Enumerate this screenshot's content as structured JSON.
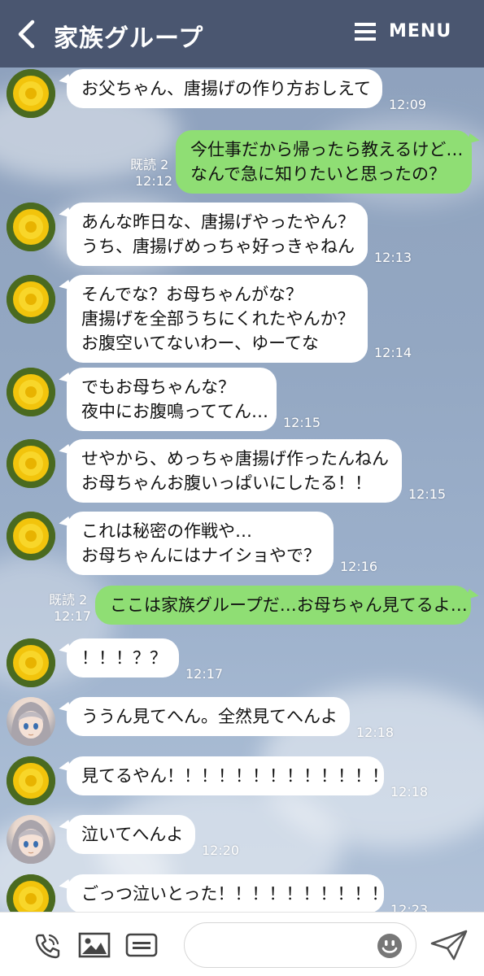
{
  "header": {
    "title": "家族グループ",
    "menu_label": "MENU"
  },
  "messages": [
    {
      "side": "left",
      "avatar": "dandelion",
      "lines": [
        "お父ちゃん、唐揚げの作り方おしえて"
      ],
      "time": "12:09"
    },
    {
      "side": "right",
      "read": "既読 2",
      "lines": [
        "今仕事だから帰ったら教えるけど…",
        "なんで急に知りたいと思ったの？"
      ],
      "time": "12:12"
    },
    {
      "side": "left",
      "avatar": "dandelion",
      "lines": [
        "あんな昨日な、唐揚げやったやん？",
        "うち、唐揚げめっちゃ好っきゃねん"
      ],
      "time": "12:13"
    },
    {
      "side": "left",
      "avatar": "dandelion",
      "lines": [
        "そんでな？お母ちゃんがな？",
        "唐揚げを全部うちにくれたやんか？",
        "お腹空いてないわー、ゆーてな"
      ],
      "time": "12:14"
    },
    {
      "side": "left",
      "avatar": "dandelion",
      "lines": [
        "でもお母ちゃんな？",
        "夜中にお腹鳴っててん…"
      ],
      "time": "12:15"
    },
    {
      "side": "left",
      "avatar": "dandelion",
      "lines": [
        "せやから、めっちゃ唐揚げ作ったんねん",
        "お母ちゃんお腹いっぱいにしたる！！"
      ],
      "time": "12:15"
    },
    {
      "side": "left",
      "avatar": "dandelion",
      "lines": [
        "これは秘密の作戦や…",
        "お母ちゃんにはナイショやで？"
      ],
      "time": "12:16"
    },
    {
      "side": "right",
      "read": "既読 2",
      "lines": [
        "ここは家族グループだ…お母ちゃん見てるよ…"
      ],
      "time": "12:17"
    },
    {
      "side": "left",
      "avatar": "dandelion",
      "lines": [
        "！！！？？"
      ],
      "time": "12:17"
    },
    {
      "side": "left",
      "avatar": "girl",
      "lines": [
        "ううん見てへん。全然見てへんよ"
      ],
      "time": "12:18"
    },
    {
      "side": "left",
      "avatar": "dandelion",
      "lines": [
        "見てるやん！！！！！！！！！！！！！"
      ],
      "time": "12:18"
    },
    {
      "side": "left",
      "avatar": "girl",
      "lines": [
        "泣いてへんよ"
      ],
      "time": "12:20"
    },
    {
      "side": "left",
      "avatar": "dandelion",
      "lines": [
        "ごっつ泣いとった！！！！！！！！！！"
      ],
      "time": "12:23"
    }
  ],
  "bottom": {
    "icons": [
      "phone-icon",
      "image-icon",
      "keyboard-icon",
      "emoji-icon",
      "send-icon"
    ],
    "input_value": "",
    "input_placeholder": ""
  }
}
